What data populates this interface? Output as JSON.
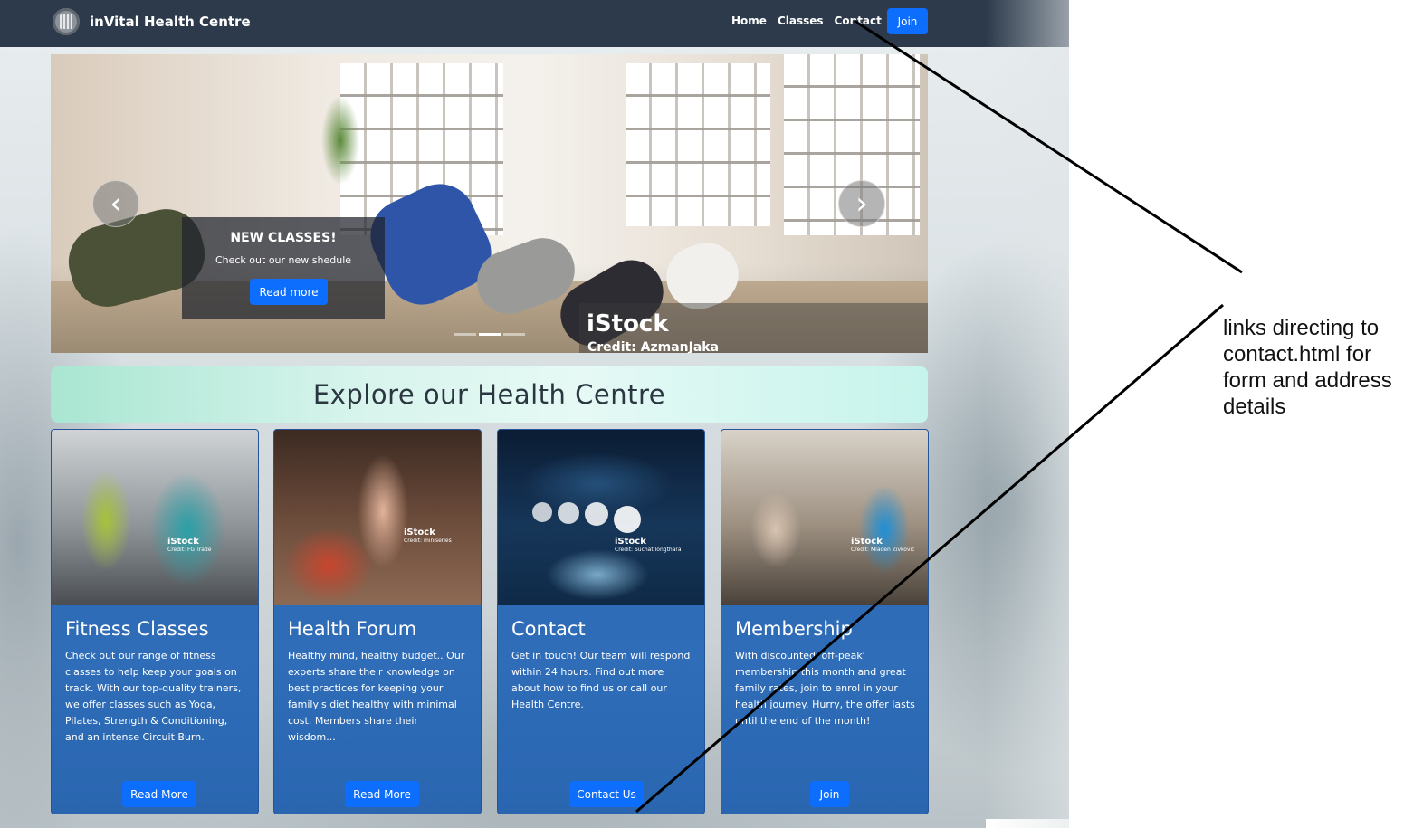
{
  "navbar": {
    "brand_name": "inVital Health Centre",
    "logo_icon": "gym-logo-icon",
    "links": [
      "Home",
      "Classes",
      "Contact"
    ],
    "join_label": "Join",
    "colors": {
      "background": "#2c3a4b",
      "join_button": "#0d6efd"
    }
  },
  "hero": {
    "caption_title": "NEW CLASSES!",
    "caption_text": "Check out our new shedule",
    "caption_button": "Read more",
    "watermark_brand": "iStock",
    "watermark_credit": "Credit: AzmanJaka",
    "prev_icon": "chevron-left-icon",
    "next_icon": "chevron-right-icon",
    "slide_count": 3,
    "active_slide": 2
  },
  "explore": {
    "title": "Explore our Health Centre"
  },
  "cards": [
    {
      "title": "Fitness Classes",
      "text": "Check out our range of fitness classes to help keep your goals on track. With our top-quality trainers, we offer classes such as Yoga, Pilates, Strength & Conditioning, and an intense Circuit Burn.",
      "button": "Read More",
      "watermark": "iStock",
      "credit": "Credit: FG Trade"
    },
    {
      "title": "Health Forum",
      "text": "Healthy mind, healthy budget.. Our experts share their knowledge on best practices for keeping your family's diet healthy with minimal cost. Members share their wisdom...",
      "button": "Read More",
      "watermark": "iStock",
      "credit": "Credit: miniseries"
    },
    {
      "title": "Contact",
      "text": "Get in touch! Our team will respond within 24 hours. Find out more about how to find us or call our Health Centre.",
      "button": "Contact Us",
      "watermark": "iStock",
      "credit": "Credit: Suchat longthara"
    },
    {
      "title": "Membership",
      "text": "With discounted 'off-peak' membership this month and great family rates, join to enrol in your health journey. Hurry, the offer lasts until the end of the month!",
      "button": "Join",
      "watermark": "iStock",
      "credit": "Credit: Mladen Zivkovic"
    }
  ],
  "annotation": {
    "lines": [
      "links directing to",
      "contact.html for",
      "form and address",
      "details"
    ]
  }
}
